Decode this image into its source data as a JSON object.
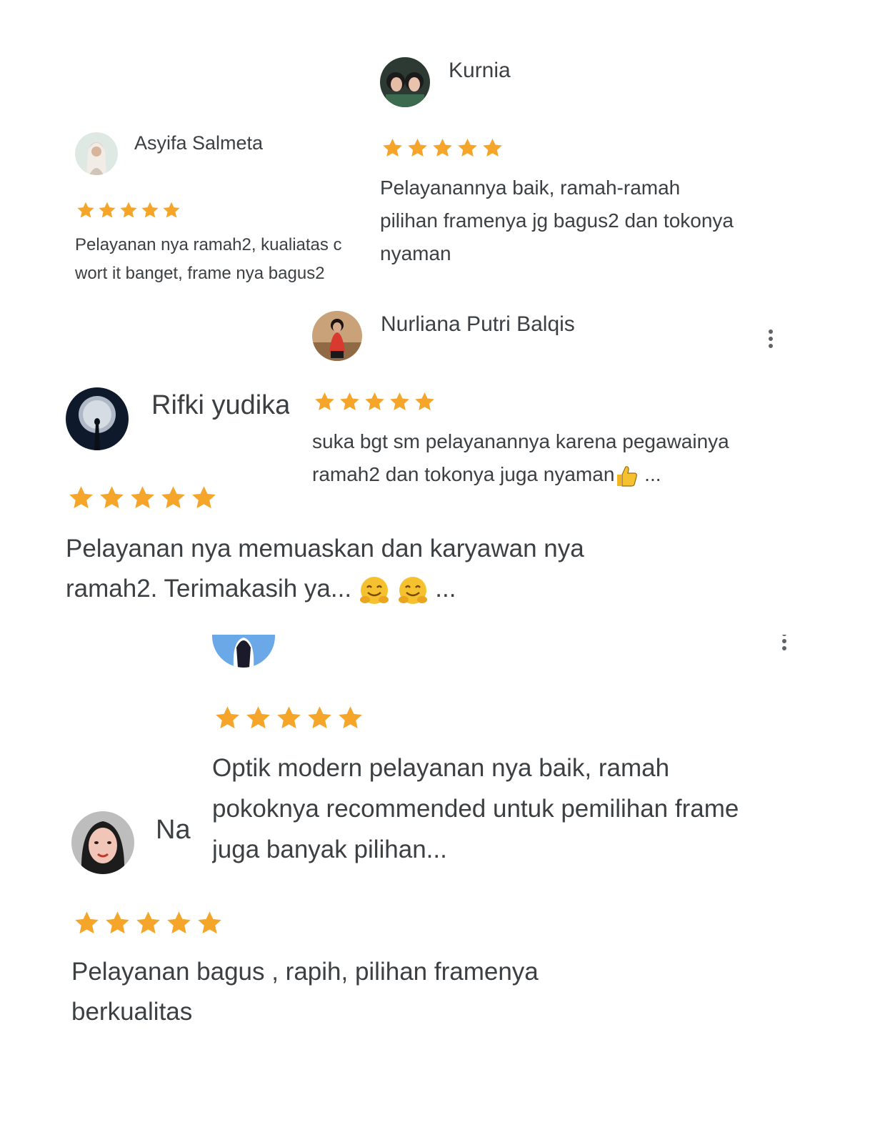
{
  "star_color": "#f4a52a",
  "reviews": [
    {
      "name": "Kurnia",
      "rating": 5,
      "avatar_icon": "two-women-avatar",
      "lines": [
        "Pelayanannya baik, ramah-ramah",
        "pilihan framenya jg bagus2 dan tokonya",
        "nyaman"
      ]
    },
    {
      "name": "Asyifa Salmeta",
      "rating": 5,
      "avatar_icon": "woman-hijab-avatar",
      "lines": [
        "Pelayanan nya ramah2, kualiatas c",
        "wort it banget, frame nya bagus2"
      ]
    },
    {
      "name": "Nurliana Putri Balqis",
      "rating": 5,
      "avatar_icon": "woman-red-dress-avatar",
      "more_icon": "more-vert-icon",
      "lines": [
        "suka bgt sm pelayanannya karena pegawainya",
        "ramah2 dan tokonya juga nyaman"
      ],
      "line2_suffix": "...",
      "emoji": "thumbs-up-emoji"
    },
    {
      "name": "Rifki yudika",
      "rating": 5,
      "avatar_icon": "moon-silhouette-avatar",
      "lines": [
        "Pelayanan nya memuaskan dan karyawan nya",
        "ramah2. Terimakasih ya..."
      ],
      "line2_suffix": "...",
      "emoji": "hugging-face-emoji"
    },
    {
      "name": "",
      "rating": 5,
      "avatar_icon": "person-sky-avatar",
      "more_icon": "more-vert-icon",
      "lines": [
        "Optik modern pelayanan nya baik, ramah",
        "pokoknya recommended untuk pemilihan frame",
        "juga banyak pilihan..."
      ]
    },
    {
      "name": "Na",
      "rating": 5,
      "avatar_icon": "woman-hijab-face-avatar",
      "lines": [
        "Pelayanan bagus , rapih, pilihan framenya",
        "berkualitas"
      ]
    }
  ]
}
